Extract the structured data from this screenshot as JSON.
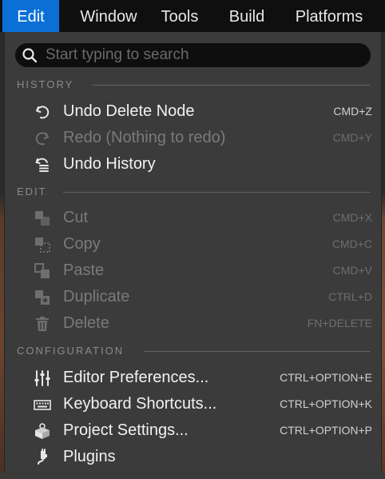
{
  "menubar": {
    "items": [
      {
        "label": "Edit",
        "active": true
      },
      {
        "label": "Window",
        "active": false
      },
      {
        "label": "Tools",
        "active": false
      },
      {
        "label": "Build",
        "active": false
      },
      {
        "label": "Platforms",
        "active": false
      }
    ]
  },
  "search": {
    "placeholder": "Start typing to search",
    "value": ""
  },
  "sections": {
    "history": {
      "title": "HISTORY",
      "items": [
        {
          "label": "Undo Delete Node",
          "shortcut": "CMD+Z",
          "icon": "undo-icon",
          "enabled": true
        },
        {
          "label": "Redo (Nothing to redo)",
          "shortcut": "CMD+Y",
          "icon": "redo-icon",
          "enabled": false
        },
        {
          "label": "Undo History",
          "shortcut": "",
          "icon": "undo-history-icon",
          "enabled": true
        }
      ]
    },
    "edit": {
      "title": "EDIT",
      "items": [
        {
          "label": "Cut",
          "shortcut": "CMD+X",
          "icon": "cut-icon",
          "enabled": false
        },
        {
          "label": "Copy",
          "shortcut": "CMD+C",
          "icon": "copy-icon",
          "enabled": false
        },
        {
          "label": "Paste",
          "shortcut": "CMD+V",
          "icon": "paste-icon",
          "enabled": false
        },
        {
          "label": "Duplicate",
          "shortcut": "CTRL+D",
          "icon": "duplicate-icon",
          "enabled": false
        },
        {
          "label": "Delete",
          "shortcut": "FN+DELETE",
          "icon": "trash-icon",
          "enabled": false
        }
      ]
    },
    "configuration": {
      "title": "CONFIGURATION",
      "items": [
        {
          "label": "Editor Preferences...",
          "shortcut": "CTRL+OPTION+E",
          "icon": "sliders-icon",
          "enabled": true
        },
        {
          "label": "Keyboard Shortcuts...",
          "shortcut": "CTRL+OPTION+K",
          "icon": "keyboard-icon",
          "enabled": true
        },
        {
          "label": "Project Settings...",
          "shortcut": "CTRL+OPTION+P",
          "icon": "project-settings-icon",
          "enabled": true
        },
        {
          "label": "Plugins",
          "shortcut": "",
          "icon": "plugin-icon",
          "enabled": true
        }
      ]
    }
  },
  "colors": {
    "menubar_bg": "#0f0f0f",
    "active_menu": "#0a70d6",
    "dropdown_bg": "#3b3b3b",
    "search_bg": "#0e0e0e",
    "enabled_text": "#f2f2f2",
    "disabled_text": "#7a7a7a"
  }
}
